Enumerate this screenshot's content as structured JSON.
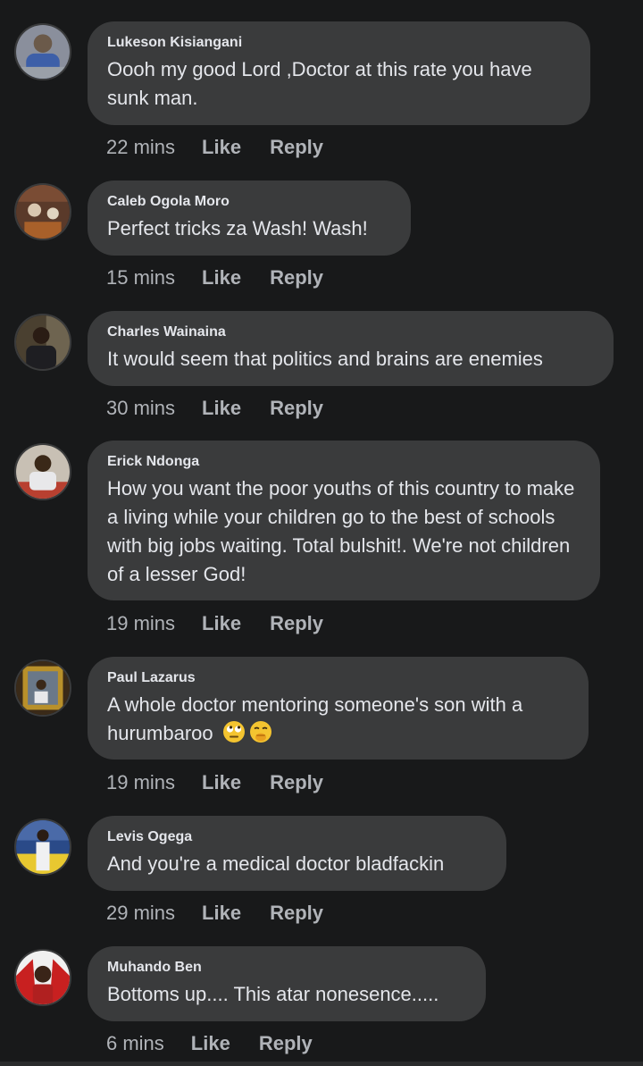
{
  "comments": [
    {
      "name": "Lukeson Kisiangani",
      "text": "Oooh my good Lord ,Doctor at this rate you have sunk man.",
      "time": "22 mins",
      "like": "Like",
      "reply": "Reply"
    },
    {
      "name": "Caleb Ogola Moro",
      "text": "Perfect tricks za Wash! Wash!",
      "time": "15 mins",
      "like": "Like",
      "reply": "Reply"
    },
    {
      "name": "Charles Wainaina",
      "text": "It would seem that politics and brains are enemies",
      "time": "30 mins",
      "like": "Like",
      "reply": "Reply"
    },
    {
      "name": "Erick Ndonga",
      "text": "How you want the poor youths of this country to make a living while your children go to the best of schools with big jobs waiting. Total bulshit!. We're not children of a lesser God!",
      "time": "19 mins",
      "like": "Like",
      "reply": "Reply"
    },
    {
      "name": "Paul Lazarus",
      "text": "A whole doctor mentoring someone's son with a hurumbaroo",
      "emojis": [
        "face-with-rolling-eyes-emoji",
        "face-with-hand-over-mouth-emoji"
      ],
      "time": "19 mins",
      "like": "Like",
      "reply": "Reply"
    },
    {
      "name": "Levis Ogega",
      "text": "And you're a medical doctor bladfackin",
      "time": "29 mins",
      "like": "Like",
      "reply": "Reply"
    },
    {
      "name": "Muhando Ben",
      "text": "Bottoms up.... This atar nonesence.....",
      "time": "6 mins",
      "like": "Like",
      "reply": "Reply"
    }
  ],
  "colors": {
    "background": "#18191a",
    "bubble": "#3a3b3c",
    "text": "#e4e6eb",
    "meta": "#b0b3b8"
  }
}
